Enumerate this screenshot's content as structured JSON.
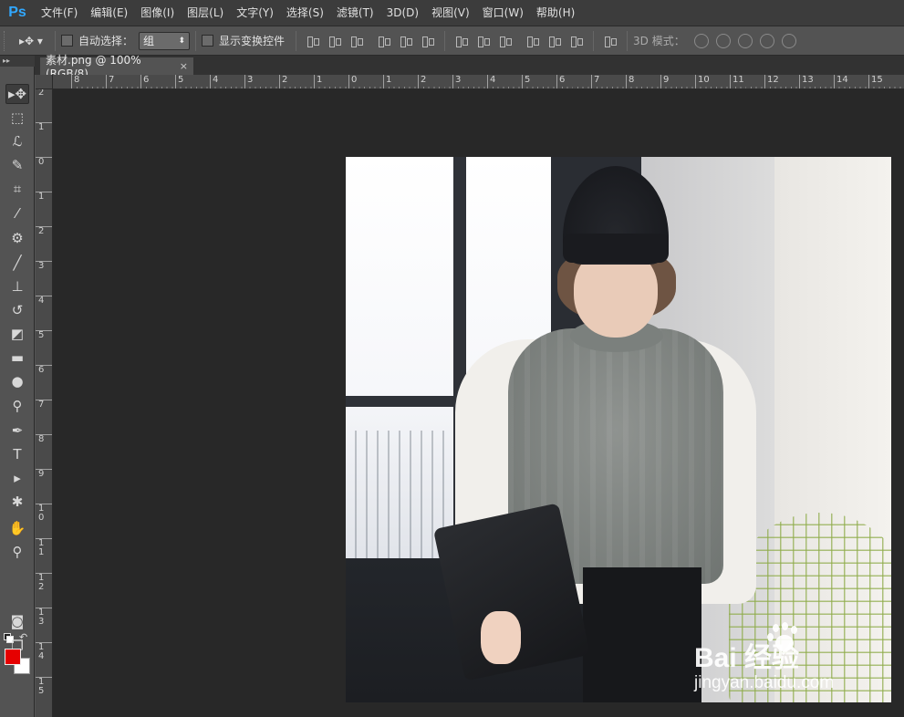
{
  "app": {
    "logo": "Ps"
  },
  "menu": [
    "文件(F)",
    "编辑(E)",
    "图像(I)",
    "图层(L)",
    "文字(Y)",
    "选择(S)",
    "滤镜(T)",
    "3D(D)",
    "视图(V)",
    "窗口(W)",
    "帮助(H)"
  ],
  "options": {
    "tool_preset": "▸✥ ▾",
    "auto_select_label": "自动选择：",
    "auto_select_value": "组",
    "show_transform_label": "显示变换控件",
    "mode3d_label": "3D 模式："
  },
  "toolbox": {
    "header": "▸▸"
  },
  "document": {
    "tab_title": "素材.png @ 100%(RGB/8)",
    "close": "×"
  },
  "ruler": {
    "top_labels": [
      "8",
      "7",
      "6",
      "5",
      "4",
      "3",
      "2",
      "1",
      "0",
      "1",
      "2",
      "3",
      "4",
      "5",
      "6",
      "7",
      "8",
      "9",
      "10",
      "11",
      "12",
      "13",
      "14",
      "15"
    ],
    "left_labels": [
      "2",
      "1",
      "0",
      "1",
      "2",
      "3",
      "4",
      "5",
      "6",
      "7",
      "8",
      "9",
      "1 0",
      "1 1",
      "1 2",
      "1 3",
      "1 4",
      "1 5"
    ]
  },
  "colors": {
    "foreground": "#e60000",
    "background": "#ffffff",
    "ps_blue": "#31a8ff",
    "canvas_bg": "#282828"
  },
  "watermark": {
    "line1": "Bai 经验",
    "line2": "jingyan.baidu.com"
  },
  "icons": [
    "move-icon",
    "marquee-icon",
    "lasso-icon",
    "quick-select-icon",
    "crop-icon",
    "eyedropper-icon",
    "healing-brush-icon",
    "brush-icon",
    "stamp-icon",
    "history-brush-icon",
    "eraser-icon",
    "gradient-icon",
    "blur-icon",
    "dodge-icon",
    "pen-icon",
    "type-icon",
    "path-select-icon",
    "shape-icon",
    "hand-icon",
    "zoom-icon",
    "quick-mask-icon",
    "screen-mode-icon"
  ]
}
